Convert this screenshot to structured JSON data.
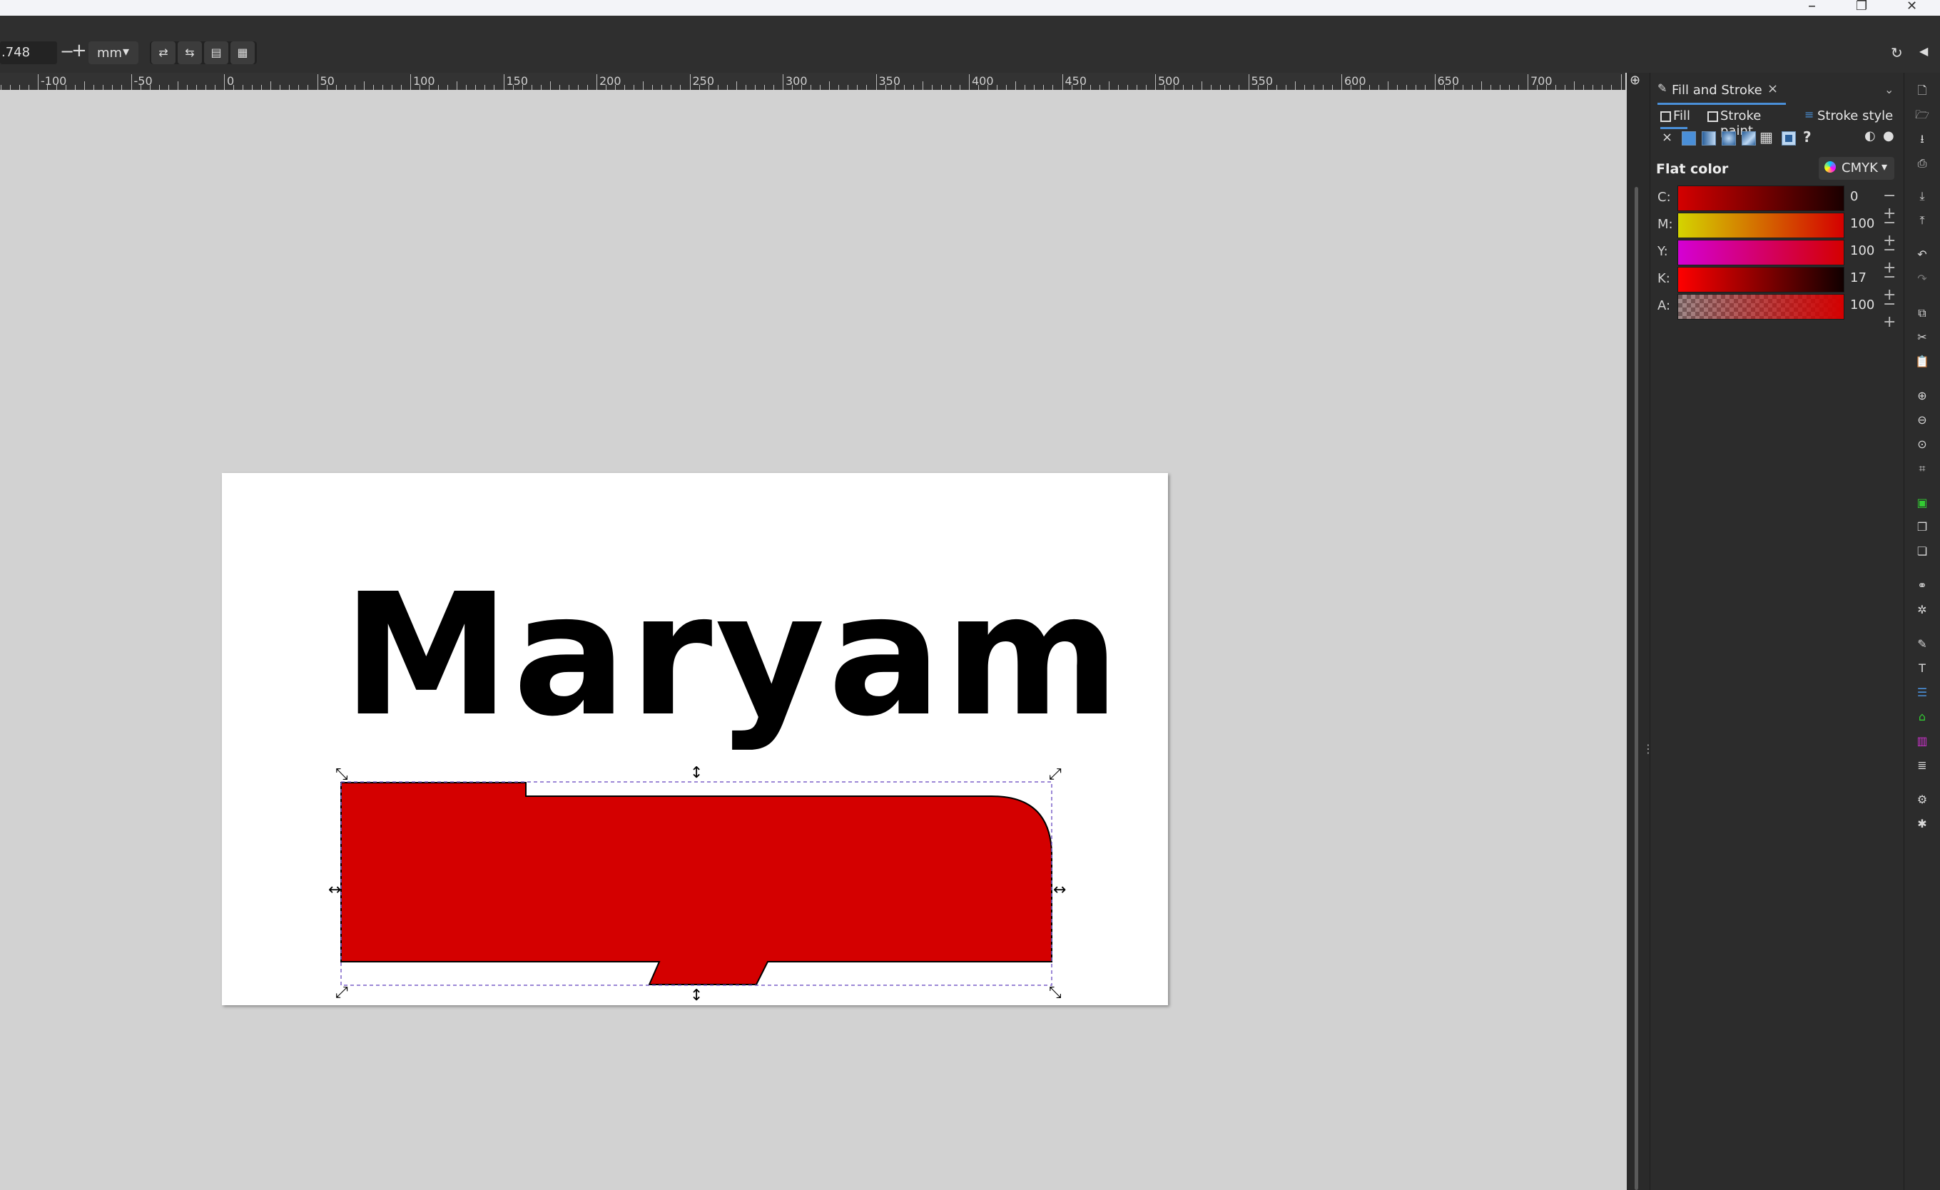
{
  "window": {
    "minimize": "–",
    "maximize": "❐",
    "close": "✕"
  },
  "toolbar": {
    "zoom_value": ".748",
    "minus": "−",
    "plus": "+",
    "unit": "mm",
    "unit_caret": "▾"
  },
  "ruler": {
    "labels": [
      "-100",
      "-50",
      "0",
      "50",
      "100",
      "150",
      "200",
      "250",
      "300",
      "350",
      "400",
      "450",
      "500",
      "550",
      "600",
      "650",
      "700"
    ]
  },
  "canvas": {
    "text": "Maryam"
  },
  "dock": {
    "tab_title": "Fill and Stroke",
    "tab_close": "×",
    "subtabs": {
      "fill": "Fill",
      "stroke_paint": "Stroke paint",
      "stroke_style": "Stroke style"
    },
    "paint_none": "×",
    "paint_unknown": "?",
    "flat_color_label": "Flat color",
    "color_mode": "CMYK",
    "channels": [
      {
        "label": "C:",
        "value": "0"
      },
      {
        "label": "M:",
        "value": "100"
      },
      {
        "label": "Y:",
        "value": "100"
      },
      {
        "label": "K:",
        "value": "17"
      },
      {
        "label": "A:",
        "value": "100"
      }
    ]
  },
  "colors": {
    "fill_red": "#d40000",
    "accent": "#4a8fd8"
  }
}
